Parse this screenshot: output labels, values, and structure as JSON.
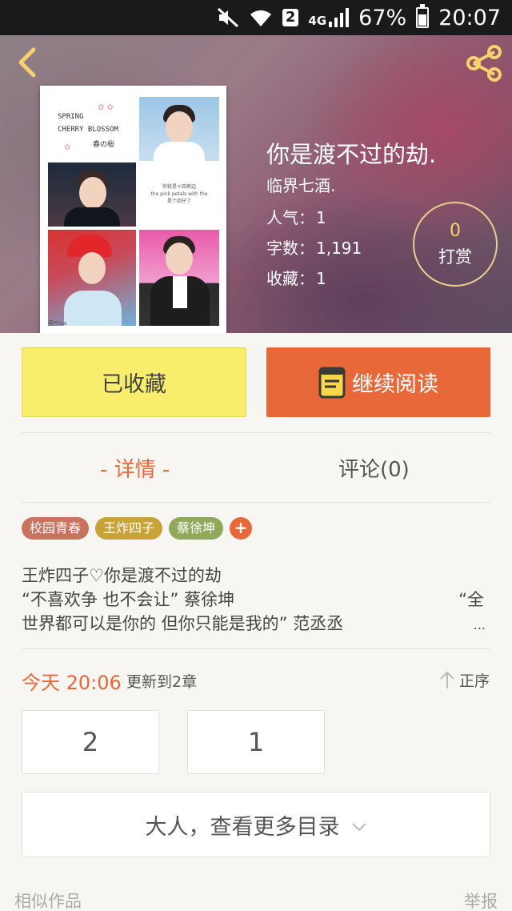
{
  "status_bar": {
    "sim": "2",
    "network": "4G",
    "battery": "67%",
    "battery_level": 0.67,
    "time": "20:07",
    "icons": [
      "mute-icon",
      "wifi-icon",
      "signal-icon",
      "battery-icon"
    ]
  },
  "header": {
    "back_icon": "chevron-left-icon",
    "share_icon": "share-icon",
    "accent_color": "#f5d36a"
  },
  "cover": {
    "line1": "SPRING",
    "line2": "CHERRY BLOSSOM",
    "line3": "春の桜",
    "center_text_1": "你就是十四侧边",
    "center_text_2": "the pink petals with the",
    "center_text_3": "是个四仔了",
    "signature": "荣Pi/sa"
  },
  "book": {
    "title": "你是渡不过的劫.",
    "author": "临界七酒.",
    "popularity_label": "人气：",
    "popularity": "1",
    "words_label": "字数：",
    "words": "1,191",
    "favorites_label": "收藏：",
    "favorites": "1"
  },
  "tip": {
    "count": "0",
    "label": "打赏"
  },
  "actions": {
    "collected_label": "已收藏",
    "read_label": "继续阅读"
  },
  "tabs": {
    "detail": "- 详情 -",
    "comments": "评论(0)"
  },
  "tags": [
    {
      "label": "校园青春",
      "color": "#c9725e"
    },
    {
      "label": "王炸四子",
      "color": "#c9a23a"
    },
    {
      "label": "蔡徐坤",
      "color": "#8fa85a"
    }
  ],
  "tag_add": "+",
  "description": {
    "line1": "王炸四子♡你是渡不过的劫",
    "line2_left": "“不喜欢争 也不会让” 蔡徐坤",
    "line2_right": "“全",
    "line3": "世界都可以是你的 但你只能是我的” 范丞丞",
    "ellipsis": "..."
  },
  "update": {
    "today": "今天 20:06",
    "text": "更新到2章",
    "order": "正序"
  },
  "chapters": [
    "2",
    "1"
  ],
  "more_catalog": "大人，查看更多目录",
  "footer": {
    "similar": "相似作品",
    "report": "举报"
  }
}
